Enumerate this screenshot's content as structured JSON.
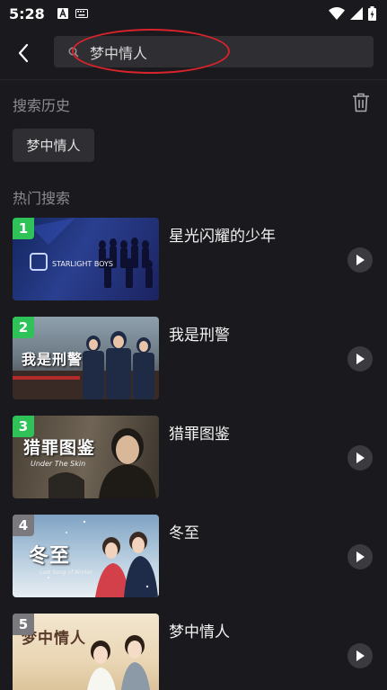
{
  "status_bar": {
    "time": "5:28",
    "left_icons": [
      "text-a-icon",
      "keyboard-icon"
    ],
    "right_icons": [
      "wifi-icon",
      "signal-icon",
      "battery-charging-icon"
    ]
  },
  "search": {
    "query": "梦中情人"
  },
  "history": {
    "title": "搜索历史",
    "items": [
      "梦中情人"
    ]
  },
  "hot": {
    "title": "热门搜索",
    "rank_colors": {
      "top": "#2fc259",
      "other": "#7a7a7e"
    },
    "items": [
      {
        "rank": "1",
        "title": "星光闪耀的少年",
        "thumb_text": "STARLIGHT BOYS"
      },
      {
        "rank": "2",
        "title": "我是刑警",
        "thumb_text": "我是刑警"
      },
      {
        "rank": "3",
        "title": "猎罪图鉴",
        "thumb_text": "猎罪图鉴",
        "thumb_sub": "Under The Skin"
      },
      {
        "rank": "4",
        "title": "冬至",
        "thumb_text": "冬至",
        "thumb_sub": "Lost Song of Winter"
      },
      {
        "rank": "5",
        "title": "梦中情人",
        "thumb_text": "梦中情人"
      }
    ]
  }
}
